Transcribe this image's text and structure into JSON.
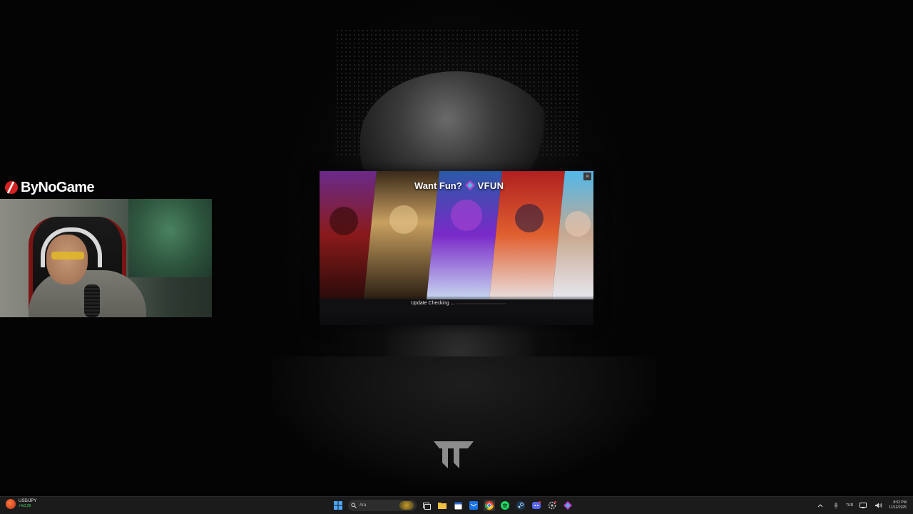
{
  "overlay": {
    "brand_name": "ByNoGame"
  },
  "launcher": {
    "title": "Want Fun?",
    "brand": "VFUN",
    "status": "Update Checking ...",
    "close_label": "×"
  },
  "taskbar": {
    "ticker_symbol": "USD/JPY",
    "ticker_change": "+%0,28",
    "search_placeholder": "Ara",
    "language": "TUR",
    "time": "8:52 PM",
    "date": "11/12/2025",
    "apps": [
      "start-icon",
      "task-view-icon",
      "file-explorer-icon",
      "calendar-icon",
      "mail-icon",
      "chrome-icon",
      "spotify-icon",
      "steam-icon",
      "discord-icon",
      "settings-icon",
      "vfun-icon"
    ]
  },
  "colors": {
    "taskbar_bg": "#1b1b1b",
    "accent_red": "#c0311a",
    "ticker_green": "#4bd26a"
  }
}
